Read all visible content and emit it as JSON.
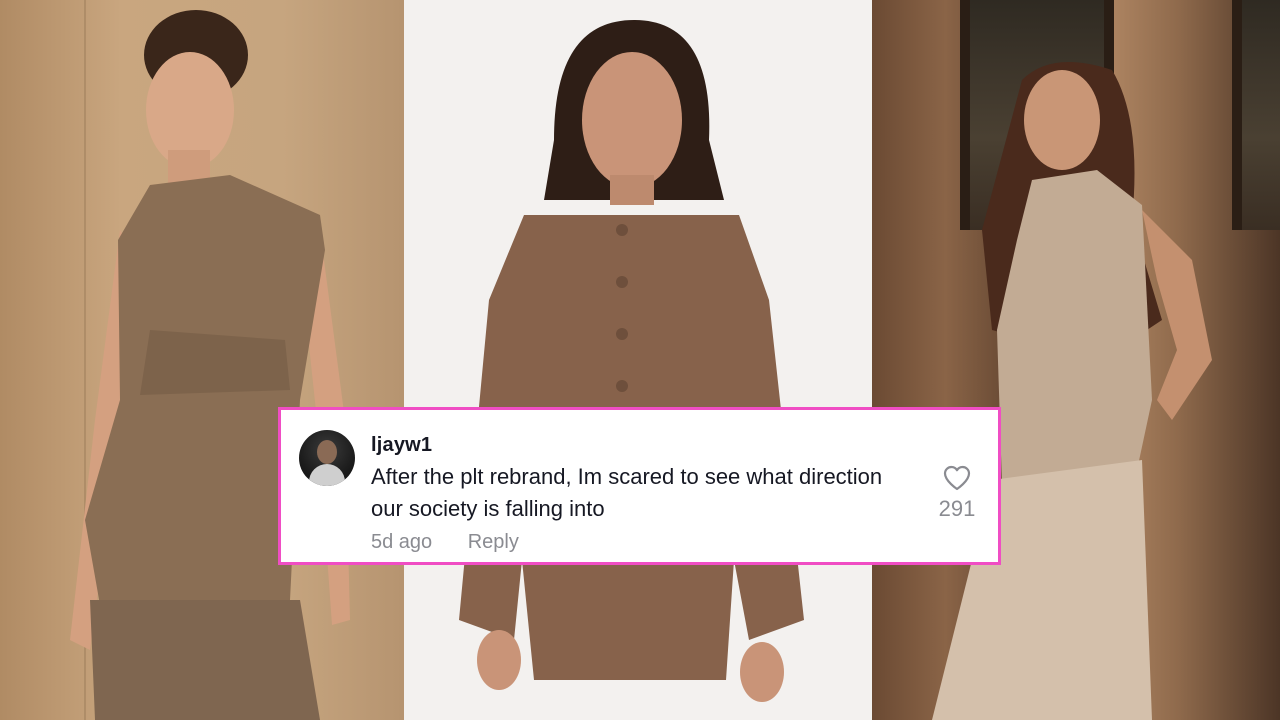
{
  "comment": {
    "username": "ljayw1",
    "text": "After the plt rebrand, Im scared to see what direction our society is falling into",
    "time_ago": "5d ago",
    "reply_label": "Reply",
    "like_count": "291",
    "like_icon": "heart-outline-icon"
  },
  "colors": {
    "card_border": "#f04dc4",
    "text_primary": "#161823",
    "text_secondary": "#8a8b91"
  },
  "panels": [
    {
      "name": "left-photo",
      "description_icon": "model-photo"
    },
    {
      "name": "middle-photo",
      "description_icon": "model-photo"
    },
    {
      "name": "right-photo",
      "description_icon": "model-photo"
    }
  ]
}
